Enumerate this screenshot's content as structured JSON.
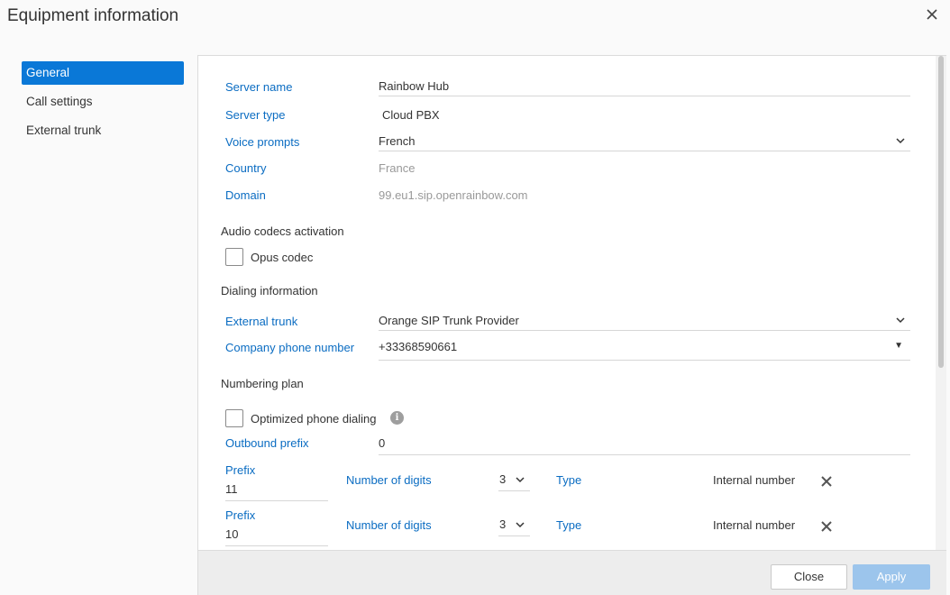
{
  "window": {
    "title": "Equipment information"
  },
  "sidebar": {
    "items": [
      {
        "label": "General",
        "active": true
      },
      {
        "label": "Call settings",
        "active": false
      },
      {
        "label": "External trunk",
        "active": false
      }
    ]
  },
  "general": {
    "server_name": {
      "label": "Server name",
      "value": "Rainbow Hub"
    },
    "server_type": {
      "label": "Server type",
      "value": "Cloud PBX"
    },
    "voice_prompts": {
      "label": "Voice prompts",
      "value": "French"
    },
    "country": {
      "label": "Country",
      "value": "France"
    },
    "domain": {
      "label": "Domain",
      "value": "99.eu1.sip.openrainbow.com"
    }
  },
  "audio_codecs": {
    "heading": "Audio codecs activation",
    "opus": {
      "label": "Opus codec",
      "checked": false
    }
  },
  "dialing": {
    "heading": "Dialing information",
    "external_trunk": {
      "label": "External trunk",
      "value": "Orange SIP Trunk Provider"
    },
    "company_phone": {
      "label": "Company phone number",
      "value": "+33368590661"
    }
  },
  "numbering": {
    "heading": "Numbering plan",
    "optimized": {
      "label": "Optimized phone dialing",
      "checked": false
    },
    "outbound_prefix": {
      "label": "Outbound prefix",
      "value": "0"
    },
    "rows": [
      {
        "prefix_label": "Prefix",
        "prefix": "11",
        "digits_label": "Number of digits",
        "digits": "3",
        "type_label": "Type",
        "type": "Internal number"
      },
      {
        "prefix_label": "Prefix",
        "prefix": "10",
        "digits_label": "Number of digits",
        "digits": "3",
        "type_label": "Type",
        "type": "Internal number"
      }
    ]
  },
  "footer": {
    "close_label": "Close",
    "apply_label": "Apply"
  },
  "colors": {
    "accent": "#0a78d7",
    "label_blue": "#0a6cc2",
    "apply_disabled": "#9cc5ec"
  }
}
